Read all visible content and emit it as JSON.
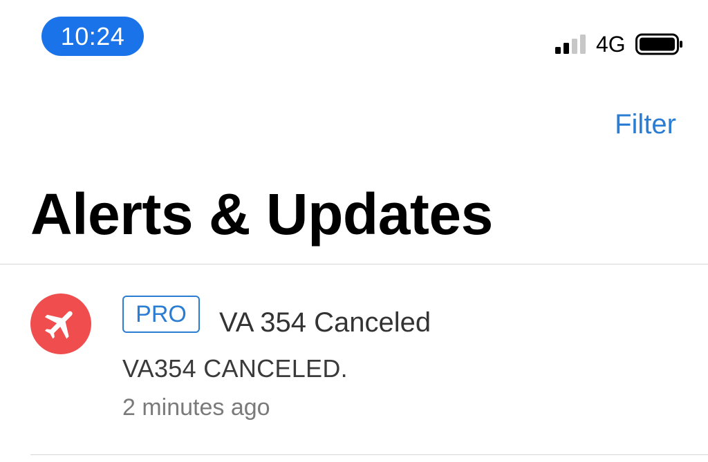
{
  "status_bar": {
    "time": "10:24",
    "network": "4G",
    "signal_bars_filled": 2,
    "signal_bars_total": 4,
    "battery_level": 1.0,
    "time_pill_color": "#1a73e8"
  },
  "header": {
    "filter_label": "Filter",
    "title": "Alerts & Updates"
  },
  "alerts": [
    {
      "badge": "PRO",
      "title": "VA 354 Canceled",
      "body": "VA354 CANCELED.",
      "time": "2 minutes ago",
      "icon": "airplane-icon",
      "icon_color": "#f04e4e"
    }
  ],
  "colors": {
    "accent": "#2b7cd3",
    "alert_red": "#f04e4e"
  }
}
